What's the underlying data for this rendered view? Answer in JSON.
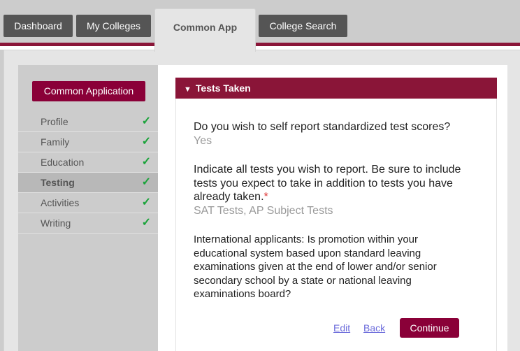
{
  "nav": {
    "tabs": [
      {
        "label": "Dashboard",
        "active": false
      },
      {
        "label": "My Colleges",
        "active": false
      },
      {
        "label": "Common App",
        "active": true
      },
      {
        "label": "College Search",
        "active": false
      }
    ]
  },
  "colors": {
    "brand": "#8a1538",
    "button": "#8a0038",
    "check": "#1aa33a",
    "link": "#6b6bdb"
  },
  "sidebar": {
    "title": "Common Application",
    "items": [
      {
        "label": "Profile",
        "status": "complete",
        "icon": "checkmark-icon",
        "glyph": "✓"
      },
      {
        "label": "Family",
        "status": "complete",
        "icon": "checkmark-icon",
        "glyph": "✓"
      },
      {
        "label": "Education",
        "status": "complete",
        "icon": "checkmark-icon",
        "glyph": "✓"
      },
      {
        "label": "Testing",
        "status": "complete",
        "active": true,
        "icon": "checkmark-icon",
        "glyph": "✓"
      },
      {
        "label": "Activities",
        "status": "complete",
        "icon": "checkmark-icon",
        "glyph": "✓"
      },
      {
        "label": "Writing",
        "status": "complete",
        "icon": "checkmark-icon",
        "glyph": "✓"
      }
    ]
  },
  "panel": {
    "toggle_glyph": "▼",
    "title": "Tests Taken",
    "questions": [
      {
        "text": "Do you wish to self report standardized test scores?",
        "answer": "Yes"
      },
      {
        "text": "Indicate all tests you wish to report. Be sure to include tests you expect to take in addition to tests you have already taken.",
        "required_mark": "*",
        "answer": "SAT Tests, AP Subject Tests"
      },
      {
        "text": "International applicants: Is promotion within your educational system based upon standard leaving examinations given at the end of lower and/or senior secondary school by a state or national leaving examinations board?"
      }
    ],
    "actions": {
      "edit": "Edit",
      "back": "Back",
      "continue": "Continue"
    }
  }
}
